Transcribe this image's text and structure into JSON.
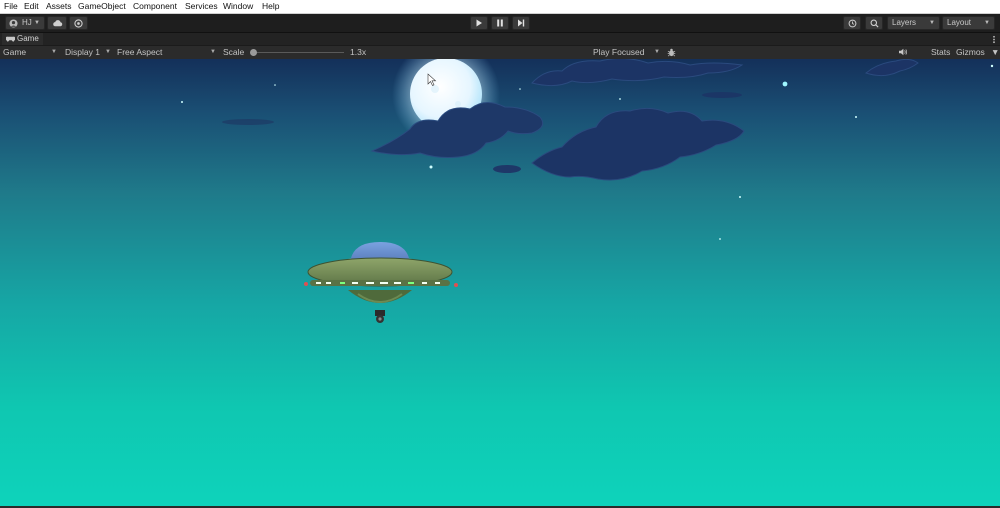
{
  "menu": [
    "File",
    "Edit",
    "Assets",
    "GameObject",
    "Component",
    "Services",
    "Window",
    "Help"
  ],
  "toolbar": {
    "account_label": "HJ",
    "layers_label": "Layers",
    "layout_label": "Layout"
  },
  "tab": {
    "title": "Game"
  },
  "gameview": {
    "mode": "Game",
    "display": "Display 1",
    "aspect": "Free Aspect",
    "scale_label": "Scale",
    "scale_value": "1.3x",
    "play_mode": "Play Focused",
    "stats": "Stats",
    "gizmos": "Gizmos"
  },
  "colors": {
    "sky_top": "#14305a",
    "sky_bottom": "#0ed3bb",
    "ufo_body": "#6f8a55",
    "ufo_dome": "#5f86c9"
  },
  "icons": [
    "account-icon",
    "cloud-icon",
    "collab-icon",
    "play-icon",
    "pause-icon",
    "step-icon",
    "history-icon",
    "search-icon",
    "game-controller-icon",
    "bug-icon",
    "mute-icon",
    "menu-dots-icon"
  ]
}
